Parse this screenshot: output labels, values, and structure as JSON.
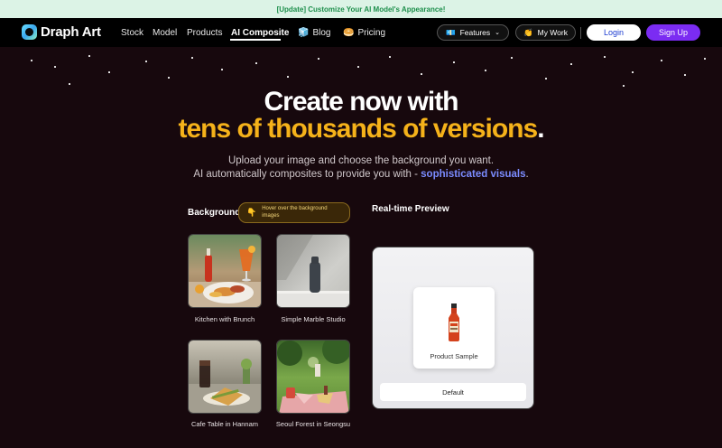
{
  "banner": {
    "text": "[Update] Customize Your AI Model's Appearance!"
  },
  "nav": {
    "logo_text": "Draph Art",
    "links": [
      {
        "label": "Stock"
      },
      {
        "label": "Model"
      },
      {
        "label": "Products"
      },
      {
        "label": "AI Composite",
        "active": true
      },
      {
        "label": "Blog",
        "icon": "🧊"
      },
      {
        "label": "Pricing",
        "icon": "🥯"
      }
    ],
    "features": {
      "label": "Features",
      "icon": "💶"
    },
    "my_work": {
      "label": "My Work",
      "icon": "👏"
    },
    "login": "Login",
    "signup": "Sign Up"
  },
  "hero": {
    "line1": "Create now with",
    "line2": "tens of thousands of versions",
    "line2_dot": ".",
    "sub1": "Upload your image and choose the background you want.",
    "sub2_prefix": "AI automatically composites to provide you with -",
    "sub2_highlight": "sophisticated visuals",
    "sub2_suffix": "."
  },
  "background": {
    "label": "Background",
    "hint_icon": "👇",
    "hint_text": "Hover over the background images",
    "items": [
      {
        "caption": "Kitchen with Brunch"
      },
      {
        "caption": "Simple Marble Studio"
      },
      {
        "caption": "Cafe Table in Hannam"
      },
      {
        "caption": "Seoul Forest in Seongsu"
      }
    ]
  },
  "preview": {
    "label": "Real-time Preview",
    "product_caption": "Product Sample",
    "default_button": "Default"
  },
  "colors": {
    "accent_yellow": "#f5b21a",
    "accent_blue": "#7b8cff",
    "signup_purple": "#7b2cf2",
    "banner_bg": "#dcf3e6",
    "banner_text": "#1e8f4c"
  }
}
